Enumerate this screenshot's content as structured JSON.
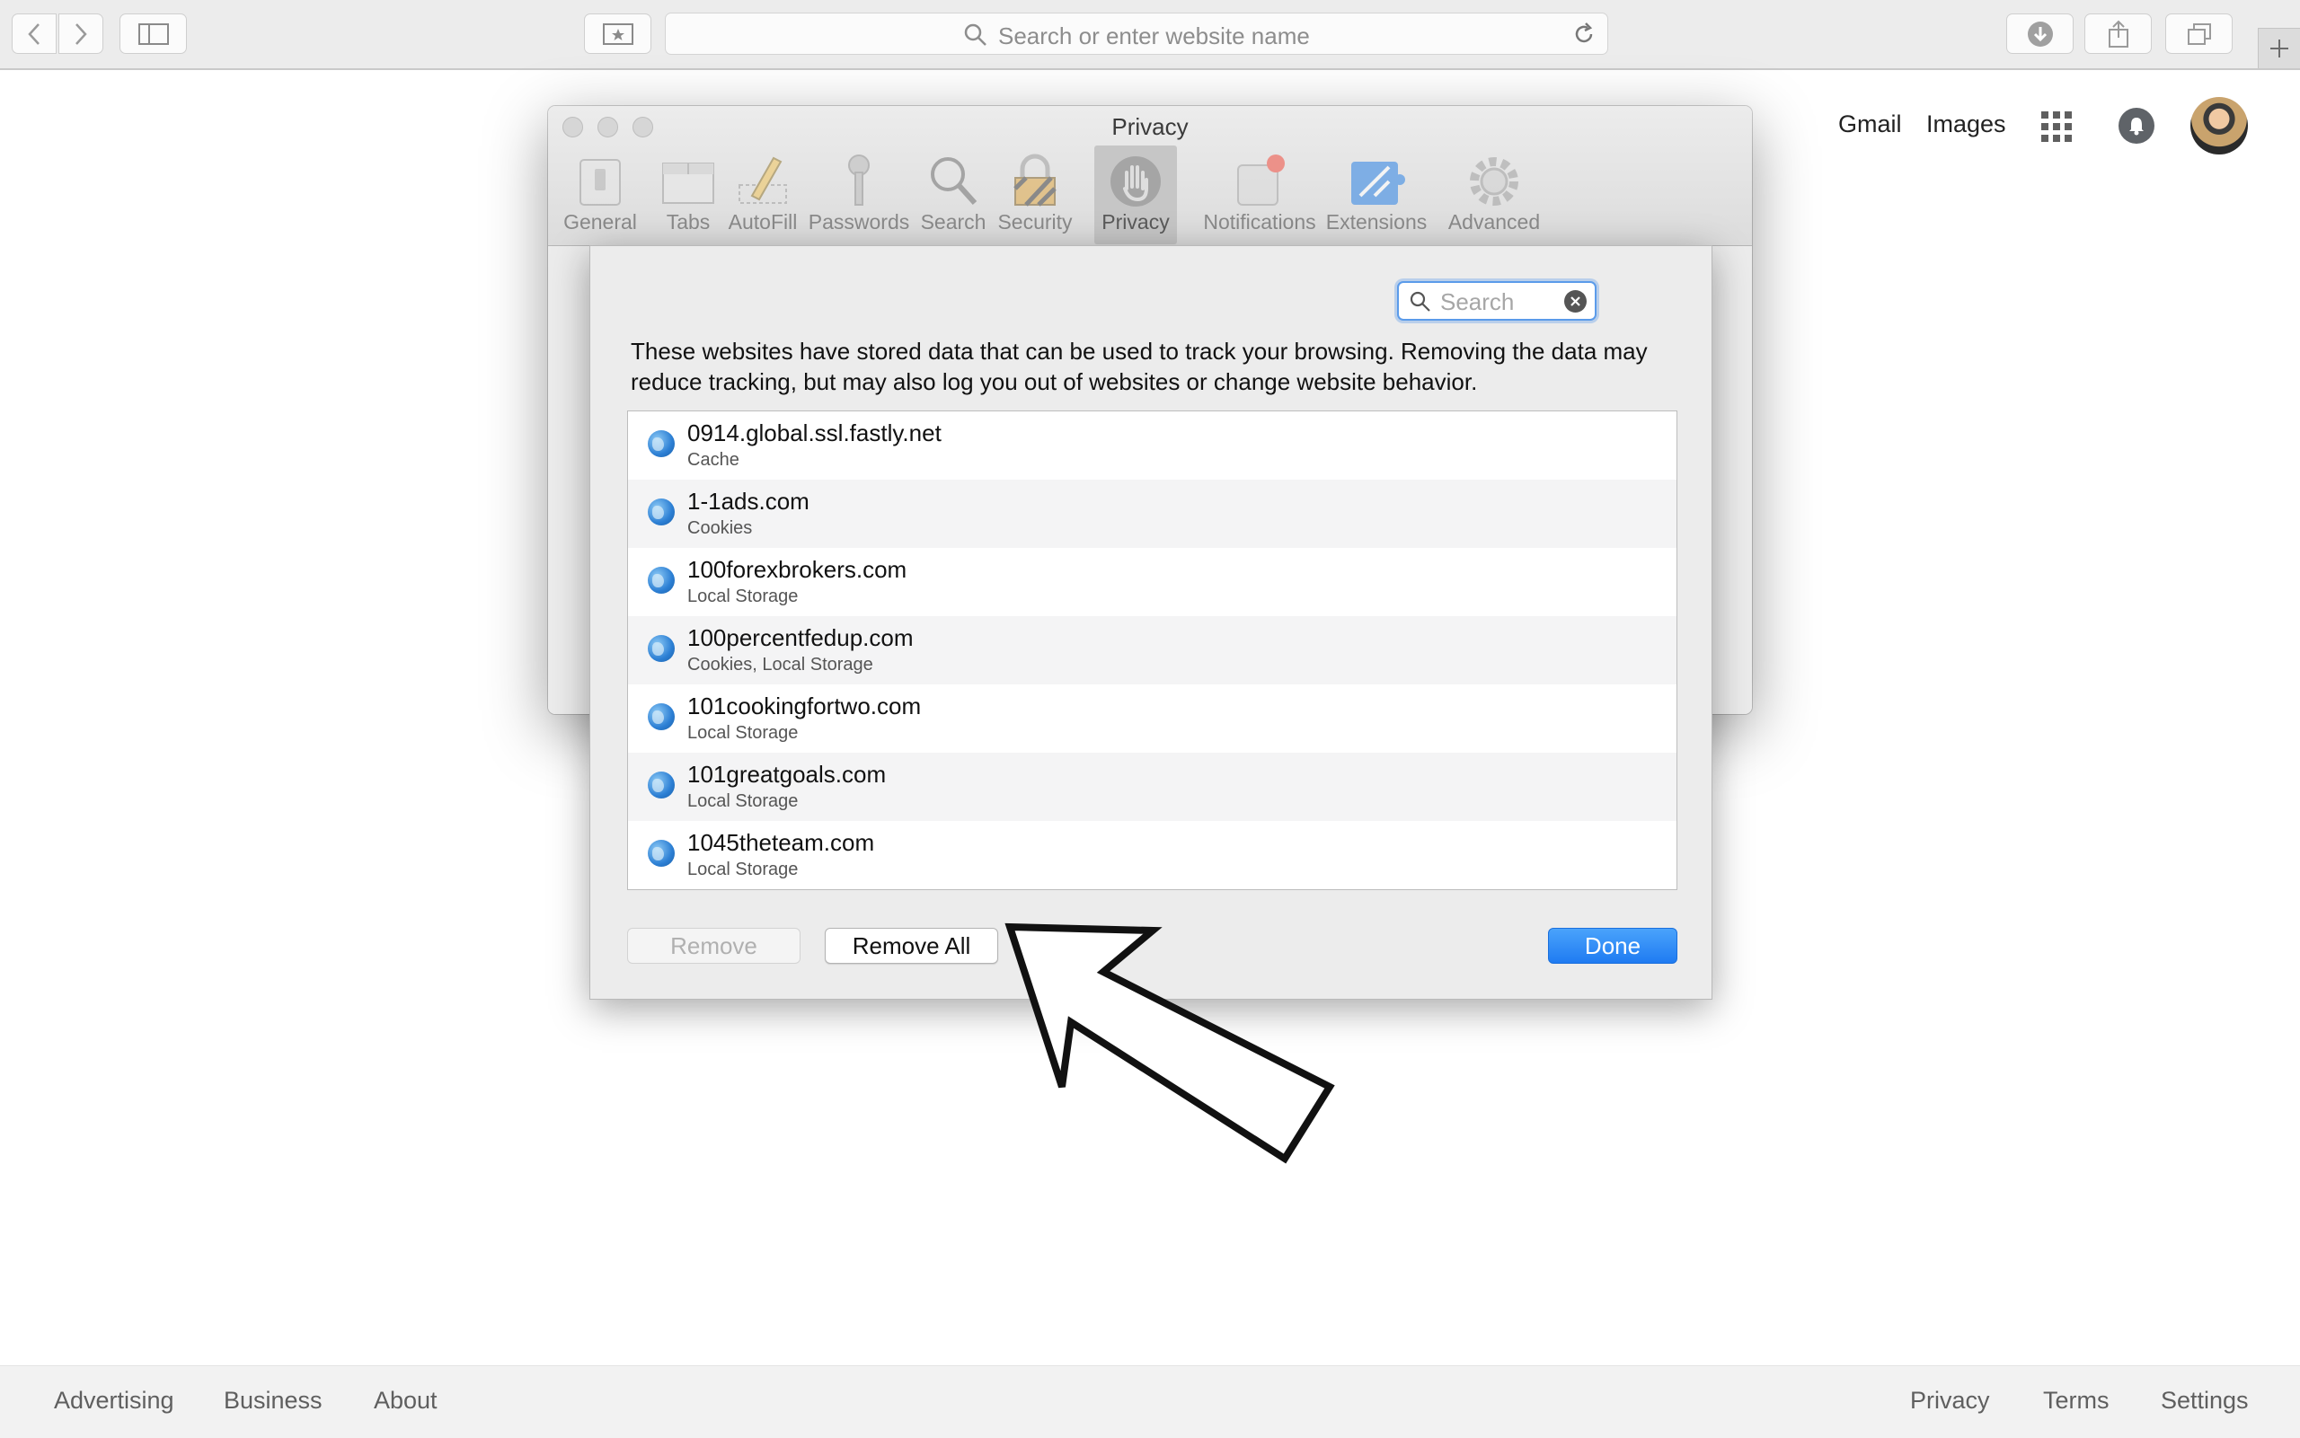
{
  "browser": {
    "address_placeholder": "Search or enter website name",
    "icons": [
      "back-icon",
      "forward-icon",
      "sidebar-icon",
      "top-sites-icon",
      "search-icon",
      "reload-icon",
      "downloads-icon",
      "share-icon",
      "tabs-icon",
      "new-tab-icon"
    ]
  },
  "google_header": {
    "gmail": "Gmail",
    "images": "Images"
  },
  "footer": {
    "left": [
      "Advertising",
      "Business",
      "About"
    ],
    "right": [
      "Privacy",
      "Terms",
      "Settings"
    ]
  },
  "preferences": {
    "title": "Privacy",
    "tabs": [
      {
        "label": "General",
        "icon": "general-icon"
      },
      {
        "label": "Tabs",
        "icon": "tabs-icon"
      },
      {
        "label": "AutoFill",
        "icon": "autofill-icon"
      },
      {
        "label": "Passwords",
        "icon": "passwords-key-icon"
      },
      {
        "label": "Search",
        "icon": "search-magnifier-icon"
      },
      {
        "label": "Security",
        "icon": "security-lock-icon"
      },
      {
        "label": "Privacy",
        "icon": "privacy-hand-icon",
        "active": true
      },
      {
        "label": "Notifications",
        "icon": "notifications-icon"
      },
      {
        "label": "Extensions",
        "icon": "extensions-icon"
      },
      {
        "label": "Advanced",
        "icon": "advanced-gear-icon"
      }
    ]
  },
  "sheet": {
    "search_placeholder": "Search",
    "description": "These websites have stored data that can be used to track your browsing. Removing the data may reduce tracking, but may also log you out of websites or change website behavior.",
    "sites": [
      {
        "name": "0914.global.ssl.fastly.net",
        "type": "Cache"
      },
      {
        "name": "1-1ads.com",
        "type": "Cookies"
      },
      {
        "name": "100forexbrokers.com",
        "type": "Local Storage"
      },
      {
        "name": "100percentfedup.com",
        "type": "Cookies, Local Storage"
      },
      {
        "name": "101cookingfortwo.com",
        "type": "Local Storage"
      },
      {
        "name": "101greatgoals.com",
        "type": "Local Storage"
      },
      {
        "name": "1045theteam.com",
        "type": "Local Storage"
      }
    ],
    "remove_label": "Remove",
    "remove_all_label": "Remove All",
    "done_label": "Done"
  },
  "colors": {
    "done_button": "#1f7bf2",
    "focus_ring": "#5b9bea",
    "notification_badge": "#f15a4d"
  }
}
